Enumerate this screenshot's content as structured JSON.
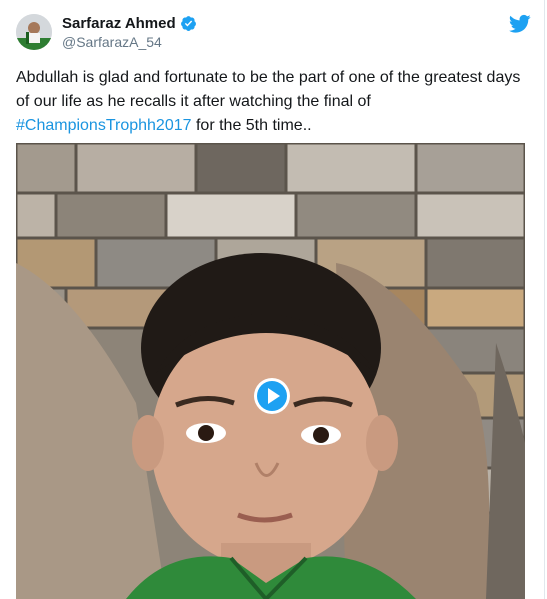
{
  "tweet": {
    "author": {
      "display_name": "Sarfaraz Ahmed",
      "handle": "@SarfarazA_54",
      "verified": true
    },
    "text_before": "Abdullah is glad and fortunate to be the part of one of the greatest days of our life as he recalls it after watching the final of ",
    "hashtag": "#ChampionsTrophh2017",
    "text_after": " for the 5th time..",
    "media": {
      "type": "video",
      "play_icon": "play-icon"
    }
  },
  "colors": {
    "brand": "#1da1f2",
    "link": "#1b95e0",
    "handle": "#657786"
  }
}
